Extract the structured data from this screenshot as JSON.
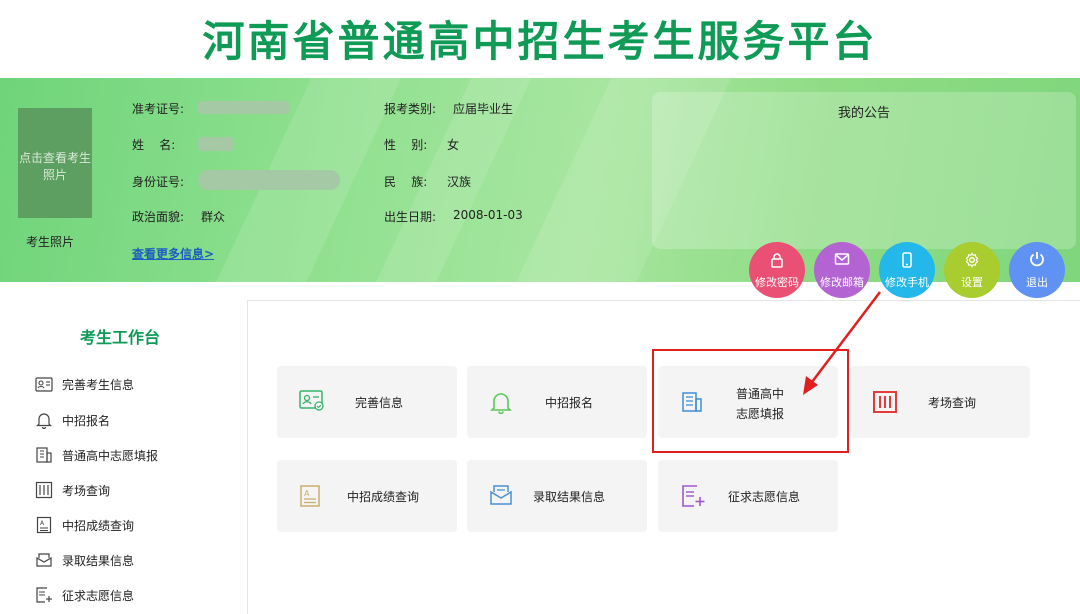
{
  "site_title": "河南省普通高中招生考生服务平台",
  "photo": {
    "button_text": "点击查看考生照片",
    "label": "考生照片"
  },
  "info": {
    "admission_no_label": "准考证号:",
    "name_label": "姓    名:",
    "id_label": "身份证号:",
    "political_label": "政治面貌:",
    "political_value": "群众",
    "category_label": "报考类别:",
    "category_value": "应届毕业生",
    "gender_label": "性    别:",
    "gender_value": "女",
    "ethnic_label": "民    族:",
    "ethnic_value": "汉族",
    "birth_label": "出生日期:",
    "birth_value": "2008-01-03",
    "more_link": "查看更多信息>"
  },
  "notice": {
    "title": "我的公告"
  },
  "actions": [
    {
      "label": "修改密码",
      "icon": "lock-icon",
      "color": "#ea4f74"
    },
    {
      "label": "修改邮箱",
      "icon": "mail-icon",
      "color": "#b463d2"
    },
    {
      "label": "修改手机",
      "icon": "phone-icon",
      "color": "#23b7ea"
    },
    {
      "label": "设置",
      "icon": "gear-icon",
      "color": "#a9cc2e"
    },
    {
      "label": "退出",
      "icon": "power-icon",
      "color": "#5f92f2"
    }
  ],
  "sidebar": {
    "title": "考生工作台",
    "items": [
      {
        "label": "完善考生信息",
        "icon": "profile-card-icon"
      },
      {
        "label": "中招报名",
        "icon": "bell-icon"
      },
      {
        "label": "普通高中志愿填报",
        "icon": "building-icon"
      },
      {
        "label": "考场查询",
        "icon": "exam-room-icon"
      },
      {
        "label": "中招成绩查询",
        "icon": "score-doc-icon"
      },
      {
        "label": "录取结果信息",
        "icon": "envelope-icon"
      },
      {
        "label": "征求志愿信息",
        "icon": "list-add-icon"
      }
    ]
  },
  "cards": [
    {
      "label": "完善信息",
      "icon": "profile-card-icon",
      "color": "#35b36a"
    },
    {
      "label": "中招报名",
      "icon": "bell-icon",
      "color": "#5cc85a"
    },
    {
      "line1": "普通高中",
      "line2": "志愿填报",
      "icon": "building-icon",
      "color": "#3d8fd8"
    },
    {
      "label": "考场查询",
      "icon": "exam-room-icon",
      "color": "#e23b3b"
    },
    {
      "label": "中招成绩查询",
      "icon": "score-doc-icon",
      "color": "#c8b06e"
    },
    {
      "label": "录取结果信息",
      "icon": "envelope-icon",
      "color": "#4a90d9"
    },
    {
      "label": "征求志愿信息",
      "icon": "list-add-icon",
      "color": "#a257c9"
    }
  ],
  "theme": {
    "brand_green": "#0f9a55",
    "highlight_red": "#e02020"
  }
}
